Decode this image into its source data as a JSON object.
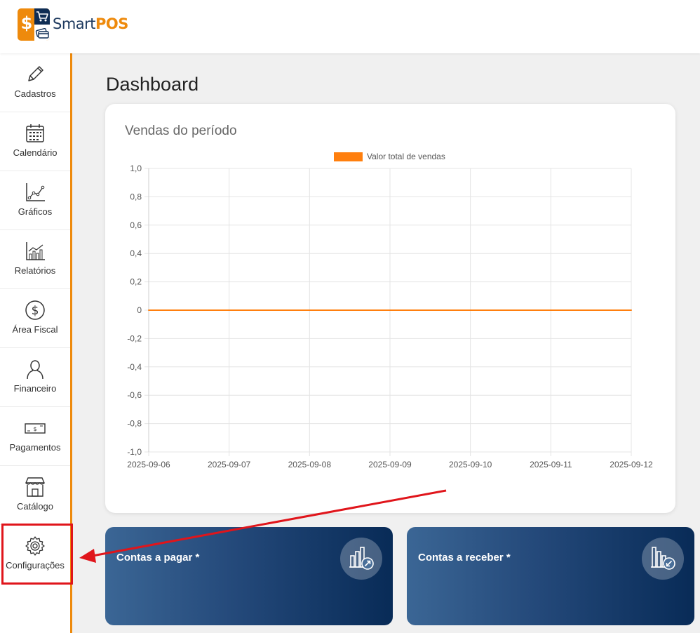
{
  "brand": {
    "name_part1": "Smart",
    "name_part2": "POS"
  },
  "sidebar": {
    "items": [
      {
        "label": "Cadastros",
        "icon": "pencil-icon"
      },
      {
        "label": "Calendário",
        "icon": "calendar-icon"
      },
      {
        "label": "Gráficos",
        "icon": "line-chart-icon"
      },
      {
        "label": "Relatórios",
        "icon": "bar-chart-icon"
      },
      {
        "label": "Área Fiscal",
        "icon": "dollar-circle-icon"
      },
      {
        "label": "Financeiro",
        "icon": "person-icon"
      },
      {
        "label": "Pagamentos",
        "icon": "banknote-icon"
      },
      {
        "label": "Catálogo",
        "icon": "storefront-icon"
      },
      {
        "label": "Configurações",
        "icon": "gear-icon"
      }
    ]
  },
  "main": {
    "title": "Dashboard",
    "chart_card": {
      "title": "Vendas do período"
    },
    "stat_cards": [
      {
        "label": "Contas a pagar *",
        "icon": "bar-chart-arrow-up-icon"
      },
      {
        "label": "Contas a receber *",
        "icon": "bar-chart-arrow-down-icon"
      }
    ]
  },
  "colors": {
    "accent": "#ee8a0c",
    "navy": "#0f2d54",
    "series": "#ff7f0e",
    "annotation": "#e0151b"
  },
  "chart_data": {
    "type": "line",
    "title": "",
    "xlabel": "",
    "ylabel": "",
    "x": [
      "2025-09-06",
      "2025-09-07",
      "2025-09-08",
      "2025-09-09",
      "2025-09-10",
      "2025-09-11",
      "2025-09-12"
    ],
    "series": [
      {
        "name": "Valor total de vendas",
        "values": [
          0,
          0,
          0,
          0,
          0,
          0,
          0
        ]
      }
    ],
    "y_ticks": [
      "1,0",
      "0,8",
      "0,6",
      "0,4",
      "0,2",
      "0",
      "-0,2",
      "-0,4",
      "-0,6",
      "-0,8",
      "-1,0"
    ],
    "ylim": [
      -1.0,
      1.0
    ],
    "grid": true,
    "legend": "top-center"
  }
}
